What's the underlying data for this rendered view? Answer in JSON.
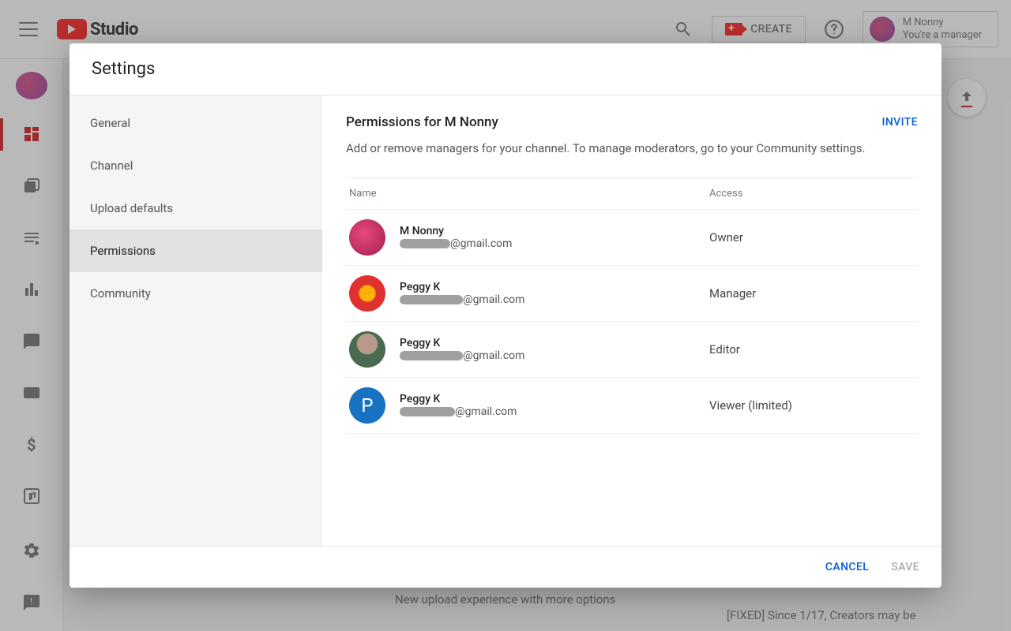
{
  "brand": {
    "name": "Studio"
  },
  "topbar": {
    "create_label": "CREATE",
    "account_name": "M Nonny",
    "account_role": "You're a manager"
  },
  "leftrail": {
    "items": [
      "dashboard",
      "videos",
      "playlists",
      "analytics",
      "comments",
      "subtitles",
      "monetization",
      "audio"
    ]
  },
  "modal": {
    "title": "Settings",
    "nav": {
      "items": [
        {
          "label": "General"
        },
        {
          "label": "Channel"
        },
        {
          "label": "Upload defaults"
        },
        {
          "label": "Permissions"
        },
        {
          "label": "Community"
        }
      ],
      "active_index": 3
    },
    "main": {
      "heading": "Permissions for M Nonny",
      "invite_label": "INVITE",
      "description": "Add or remove managers for your channel. To manage moderators, go to your Community settings.",
      "columns": {
        "name": "Name",
        "access": "Access"
      },
      "rows": [
        {
          "name": "M Nonny",
          "email_suffix": "@gmail.com",
          "mask_w": 64,
          "access": "Owner",
          "avatar": "pink"
        },
        {
          "name": "Peggy K",
          "email_suffix": "@gmail.com",
          "mask_w": 80,
          "access": "Manager",
          "avatar": "flower"
        },
        {
          "name": "Peggy K",
          "email_suffix": "@gmail.com",
          "mask_w": 80,
          "access": "Editor",
          "avatar": "photo"
        },
        {
          "name": "Peggy K",
          "email_suffix": "@gmail.com",
          "mask_w": 70,
          "access": "Viewer (limited)",
          "avatar": "letter",
          "letter": "P"
        }
      ]
    },
    "footer": {
      "cancel": "CANCEL",
      "save": "SAVE"
    }
  },
  "background": {
    "card1": "New upload experience with more options",
    "card2": "[FIXED] Since 1/17, Creators may be"
  }
}
